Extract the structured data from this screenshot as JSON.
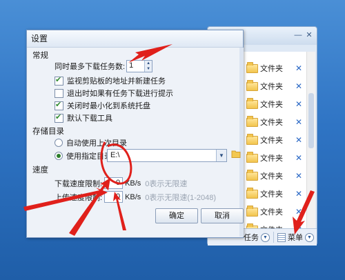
{
  "dialog": {
    "title": "设置",
    "general": {
      "heading": "常规",
      "max_tasks_label": "同时最多下载任务数:",
      "max_tasks_value": "1",
      "options": [
        {
          "label": "监视剪贴板的地址并新建任务",
          "checked": true
        },
        {
          "label": "退出时如果有任务下载进行提示",
          "checked": false
        },
        {
          "label": "关闭时最小化到系统托盘",
          "checked": true
        },
        {
          "label": "默认下载工具",
          "checked": true
        }
      ]
    },
    "storage": {
      "heading": "存储目录",
      "auto_label": "自动使用上次目录",
      "custom_label": "使用指定目录",
      "path_value": "E:\\"
    },
    "speed": {
      "heading": "速度",
      "download_label": "下载速度限制:",
      "download_value": "0",
      "download_unit": "KB/s",
      "download_hint": "0表示无限速",
      "upload_label": "上传速度限制:",
      "upload_value": "0",
      "upload_unit": "KB/s",
      "upload_hint": "0表示无限速(1-2048)"
    },
    "ok_label": "确定",
    "cancel_label": "取消"
  },
  "background_window": {
    "folder_label": "文件夹",
    "folders": [
      "文件夹",
      "文件夹",
      "文件夹",
      "文件夹",
      "文件夹",
      "文件夹",
      "文件夹",
      "文件夹",
      "文件夹",
      "文件夹"
    ],
    "tasks_label": "任务",
    "menu_label": "菜单"
  },
  "colors": {
    "annotation": "#e0201b",
    "accent": "#2a68c5"
  },
  "icons": [
    "close-icon",
    "folder-icon",
    "delete-icon",
    "menu-icon",
    "checkbox-icon",
    "radio-icon",
    "browse-folder-icon"
  ]
}
